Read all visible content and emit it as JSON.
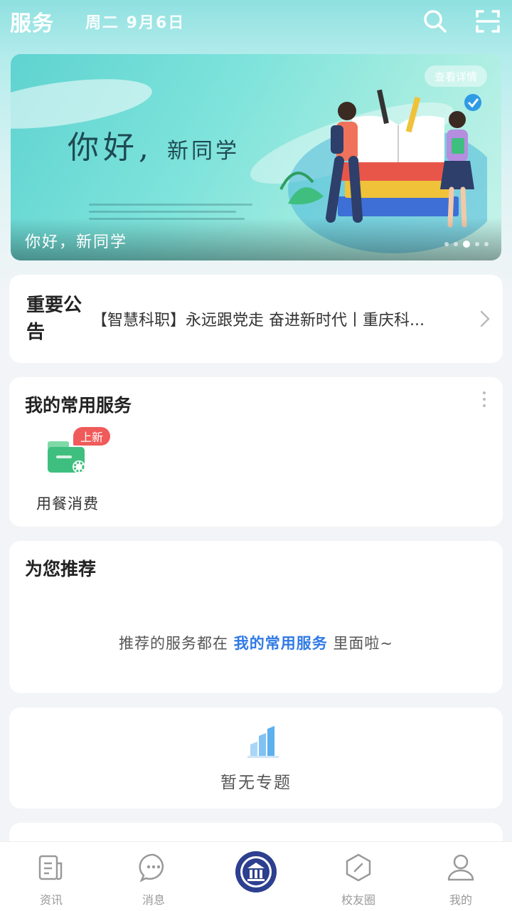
{
  "header": {
    "title": "服务",
    "date": "周二  9月6日",
    "search_icon": "search-icon",
    "scan_icon": "scan-icon"
  },
  "banner": {
    "headline_main": "你好",
    "headline_sub": "新同学",
    "detail_label": "查看详情",
    "caption": "你好，新同学",
    "slide_count": 5,
    "active_slide": 3
  },
  "notice": {
    "tag": "重要公告",
    "text": "【智慧科职】永远跟党走 奋进新时代丨重庆科..."
  },
  "services": {
    "title": "我的常用服务",
    "items": [
      {
        "label": "用餐消费",
        "badge": "上新",
        "icon": "wallet-icon",
        "color": "#3fbf7f"
      }
    ]
  },
  "recommend": {
    "title": "为您推荐",
    "empty_prefix": "推荐的服务都在 ",
    "empty_link": "我的常用服务",
    "empty_suffix": " 里面啦~"
  },
  "topics": {
    "empty_label": "暂无专题",
    "icon": "bar-chart-icon"
  },
  "tabbar": {
    "items": [
      {
        "label": "资讯",
        "icon": "news-icon"
      },
      {
        "label": "消息",
        "icon": "message-icon"
      },
      {
        "label": "",
        "icon": "school-logo-icon"
      },
      {
        "label": "校友圈",
        "icon": "alumni-icon"
      },
      {
        "label": "我的",
        "icon": "profile-icon"
      }
    ]
  },
  "colors": {
    "accent": "#2f7ae5",
    "badge": "#f05a5a",
    "banner_teal": "#5fd3d0",
    "school_blue": "#2d3f8f"
  }
}
